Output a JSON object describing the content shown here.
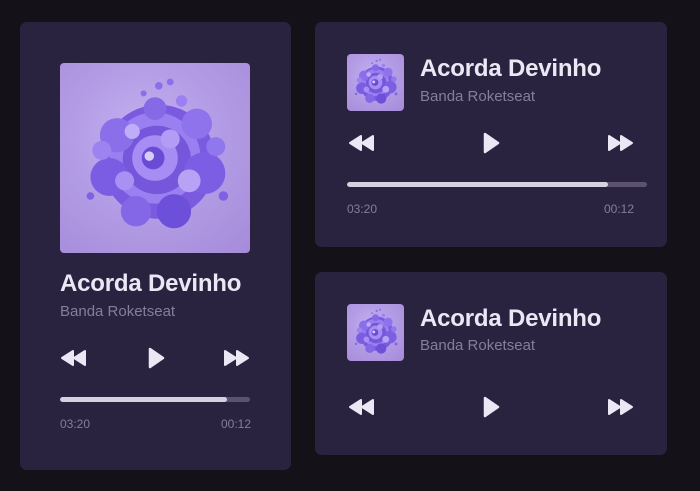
{
  "players": [
    {
      "id": "large",
      "title": "Acorda Devinho",
      "artist": "Banda Roketseat",
      "elapsed": "03:20",
      "remaining": "00:12",
      "progress": 0.88
    },
    {
      "id": "compact",
      "title": "Acorda Devinho",
      "artist": "Banda Roketseat",
      "elapsed": "03:20",
      "remaining": "00:12",
      "progress": 0.87
    },
    {
      "id": "mini",
      "title": "Acorda Devinho",
      "artist": "Banda Roketseat"
    }
  ],
  "icons": {
    "previous": "rewind-icon",
    "play": "play-icon",
    "next": "fast-forward-icon"
  },
  "colors": {
    "background": "#141118",
    "card": "#2a2340",
    "accent": "#8b5cf6",
    "text": "#ebe7f4",
    "muted": "#857e99",
    "progress_fill": "#d6d1e0",
    "progress_track": "#5a5270"
  }
}
